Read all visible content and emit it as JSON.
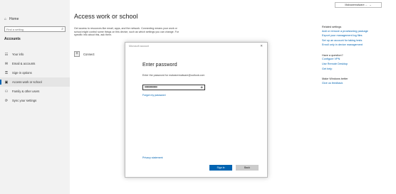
{
  "sidebar": {
    "home_label": "Home",
    "find_placeholder": "Find a setting",
    "section_title": "Accounts",
    "items": [
      {
        "label": "Your info",
        "icon": "person-card-icon"
      },
      {
        "label": "Email & accounts",
        "icon": "mail-icon"
      },
      {
        "label": "Sign-in options",
        "icon": "key-icon"
      },
      {
        "label": "Access work or school",
        "icon": "briefcase-icon"
      },
      {
        "label": "Family & other users",
        "icon": "people-icon"
      },
      {
        "label": "Sync your settings",
        "icon": "sync-icon"
      }
    ]
  },
  "main": {
    "title": "Access work or school",
    "description": "Get access to resources like email, apps, and the network. Connecting means your work or school might control some things on this device, such as which settings you can change. For specific info about this, ask them.",
    "connect_label": "Connect"
  },
  "user_chip": {
    "label": "Malwaremalware ..."
  },
  "right_panel": {
    "related_title": "Related settings",
    "related_links": [
      "Add or remove a provisioning package",
      "Export your management log files",
      "Set up an account for taking tests",
      "Enroll only in device management"
    ],
    "question_title": "Have a question?",
    "question_links": [
      "Configure VPN",
      "Use Remote Desktop",
      "Get help"
    ],
    "better_title": "Make Windows better",
    "better_links": [
      "Give us feedback"
    ]
  },
  "dialog": {
    "window_title": "Microsoft account",
    "heading": "Enter password",
    "label": "Enter the password for malwaremalware@outlook.com",
    "password_masked": "••••••••••••••",
    "forgot_link": "Forgot my password",
    "privacy_link": "Privacy statement",
    "signin_label": "Sign in",
    "back_label": "Back"
  }
}
